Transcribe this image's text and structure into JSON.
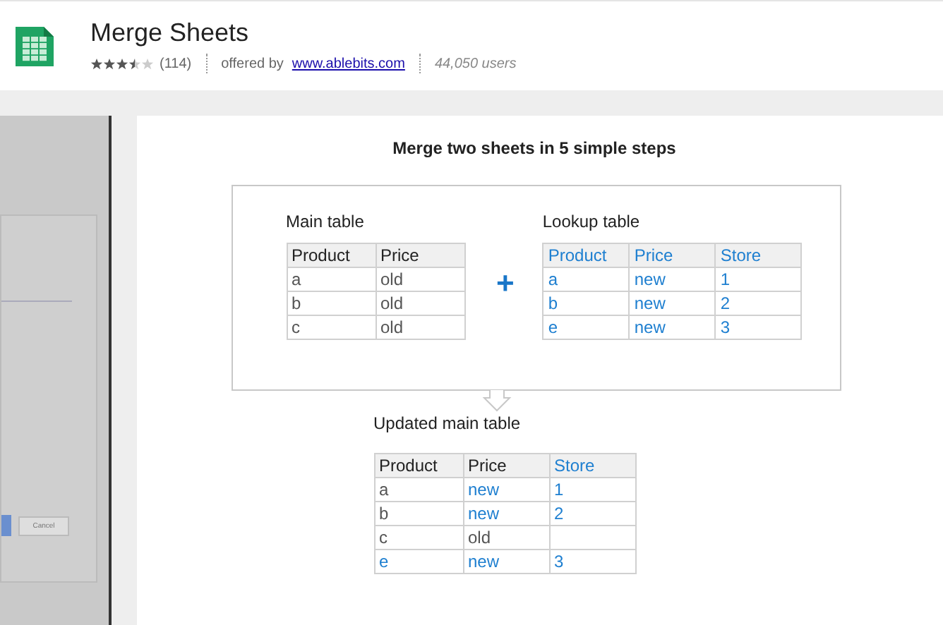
{
  "header": {
    "title": "Merge Sheets",
    "stars": 3.5,
    "rating_count": "(114)",
    "offered_by_label": "offered by",
    "offered_by_link": "www.ablebits.com",
    "users": "44,050 users"
  },
  "background_screenshot": {
    "cancel_button": "Cancel"
  },
  "slide": {
    "title": "Merge two sheets in 5 simple steps",
    "main_table": {
      "caption": "Main table",
      "rows": [
        [
          {
            "text": "Product",
            "new": false
          },
          {
            "text": "Price",
            "new": false
          }
        ],
        [
          {
            "text": "a",
            "new": false
          },
          {
            "text": "old",
            "new": false
          }
        ],
        [
          {
            "text": "b",
            "new": false
          },
          {
            "text": "old",
            "new": false
          }
        ],
        [
          {
            "text": "c",
            "new": false
          },
          {
            "text": "old",
            "new": false
          }
        ]
      ]
    },
    "plus": "+",
    "lookup_table": {
      "caption": "Lookup table",
      "rows": [
        [
          {
            "text": "Product",
            "new": true
          },
          {
            "text": "Price",
            "new": true
          },
          {
            "text": "Store",
            "new": true
          }
        ],
        [
          {
            "text": "a",
            "new": true
          },
          {
            "text": "new",
            "new": true
          },
          {
            "text": "1",
            "new": true
          }
        ],
        [
          {
            "text": "b",
            "new": true
          },
          {
            "text": "new",
            "new": true
          },
          {
            "text": "2",
            "new": true
          }
        ],
        [
          {
            "text": "e",
            "new": true
          },
          {
            "text": "new",
            "new": true
          },
          {
            "text": "3",
            "new": true
          }
        ]
      ]
    },
    "updated_table": {
      "caption": "Updated main table",
      "rows": [
        [
          {
            "text": "Product",
            "new": false
          },
          {
            "text": "Price",
            "new": false
          },
          {
            "text": "Store",
            "new": true
          }
        ],
        [
          {
            "text": "a",
            "new": false
          },
          {
            "text": "new",
            "new": true
          },
          {
            "text": "1",
            "new": true
          }
        ],
        [
          {
            "text": "b",
            "new": false
          },
          {
            "text": "new",
            "new": true
          },
          {
            "text": "2",
            "new": true
          }
        ],
        [
          {
            "text": "c",
            "new": false
          },
          {
            "text": "old",
            "new": false
          },
          null
        ],
        [
          {
            "text": "e",
            "new": true
          },
          {
            "text": "new",
            "new": true
          },
          {
            "text": "3",
            "new": true
          }
        ]
      ]
    }
  }
}
